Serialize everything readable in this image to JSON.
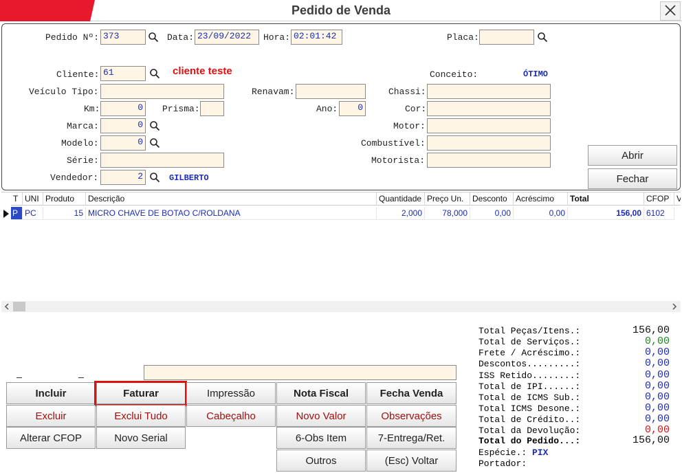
{
  "window": {
    "title": "Pedido de Venda"
  },
  "header": {
    "pedido_label": "Pedido Nº:",
    "pedido_value": "373",
    "data_label": "Data:",
    "data_value": "23/09/2022",
    "hora_label": "Hora:",
    "hora_value": "02:01:42",
    "placa_label": "Placa:",
    "placa_value": "",
    "cliente_label": "Cliente:",
    "cliente_value": "61",
    "cliente_name": "cliente teste",
    "conceito_label": "Conceito:",
    "conceito_value": "ÓTIMO",
    "veiculo_label": "Veículo Tipo:",
    "veiculo_value": "",
    "renavam_label": "Renavam:",
    "renavam_value": "",
    "chassi_label": "Chassi:",
    "chassi_value": "",
    "km_label": "Km:",
    "km_value": "0",
    "prisma_label": "Prisma:",
    "prisma_value": "",
    "ano_label": "Ano:",
    "ano_value": "0",
    "cor_label": "Cor:",
    "cor_value": "",
    "marca_label": "Marca:",
    "marca_value": "0",
    "motor_label": "Motor:",
    "motor_value": "",
    "modelo_label": "Modelo:",
    "modelo_value": "0",
    "combustivel_label": "Combustível:",
    "combustivel_value": "",
    "serie_label": "Série:",
    "serie_value": "",
    "motorista_label": "Motorista:",
    "motorista_value": "",
    "vendedor_label": "Vendedor:",
    "vendedor_value": "2",
    "vendedor_name": "GILBERTO",
    "abrir_label": "Abrir",
    "fechar_label": "Fechar"
  },
  "grid": {
    "columns": [
      "T",
      "UNI",
      "Produto",
      "Descrição",
      "Quantidade",
      "Preço Un.",
      "Desconto",
      "Acréscimo",
      "Total",
      "CFOP",
      "V"
    ],
    "row": {
      "t": "P",
      "uni": "PC",
      "produto": "15",
      "descricao": "MICRO CHAVE DE BOTAO C/ROLDANA",
      "quantidade": "2,000",
      "preco": "78,000",
      "desconto": "0,00",
      "acrescimo": "0,00",
      "total": "156,00",
      "cfop": "6102"
    }
  },
  "buttons": {
    "incluir": "Incluir",
    "faturar": "Faturar",
    "impressao": "Impressão",
    "nota_fiscal": "Nota Fiscal",
    "fecha_venda": "Fecha Venda",
    "excluir": "Excluir",
    "exclui_tudo": "Exclui Tudo",
    "cabecalho": "Cabeçalho",
    "novo_valor": "Novo Valor",
    "observacoes": "Observações",
    "alterar_cfop": "Alterar CFOP",
    "novo_serial": "Novo Serial",
    "obs_item": "6-Obs Item",
    "entrega": "7-Entrega/Ret.",
    "outros": "Outros",
    "voltar": "(Esc) Voltar"
  },
  "totals": {
    "pecas_label": "Total Peças/Itens.:",
    "pecas_value": "156,00",
    "servicos_label": "Total de Serviços.:",
    "servicos_value": "0,00",
    "frete_label": "Frete / Acréscimo.:",
    "frete_value": "0,00",
    "descontos_label": "Descontos.........:",
    "descontos_value": "0,00",
    "iss_label": "ISS Retido........:",
    "iss_value": "0,00",
    "ipi_label": "Total de IPI......:",
    "ipi_value": "0,00",
    "icms_sub_label": "Total de ICMS Sub.:",
    "icms_sub_value": "0,00",
    "icms_des_label": "Total ICMS Desone.:",
    "icms_des_value": "0,00",
    "credito_label": "Total de Crédito..:",
    "credito_value": "0,00",
    "devolucao_label": "Total da Devolução:",
    "devolucao_value": "0,00",
    "pedido_label": "Total do Pedido...:",
    "pedido_value": "156,00",
    "especie_label": "Espécie.:",
    "especie_value": "PIX",
    "portador_label": "Portador:"
  },
  "colors": {
    "accent_red": "#e8192c",
    "field_bg": "#fdf6e6",
    "value_blue": "#1a2cb8",
    "green": "#1a8a1a",
    "red": "#e01010"
  }
}
